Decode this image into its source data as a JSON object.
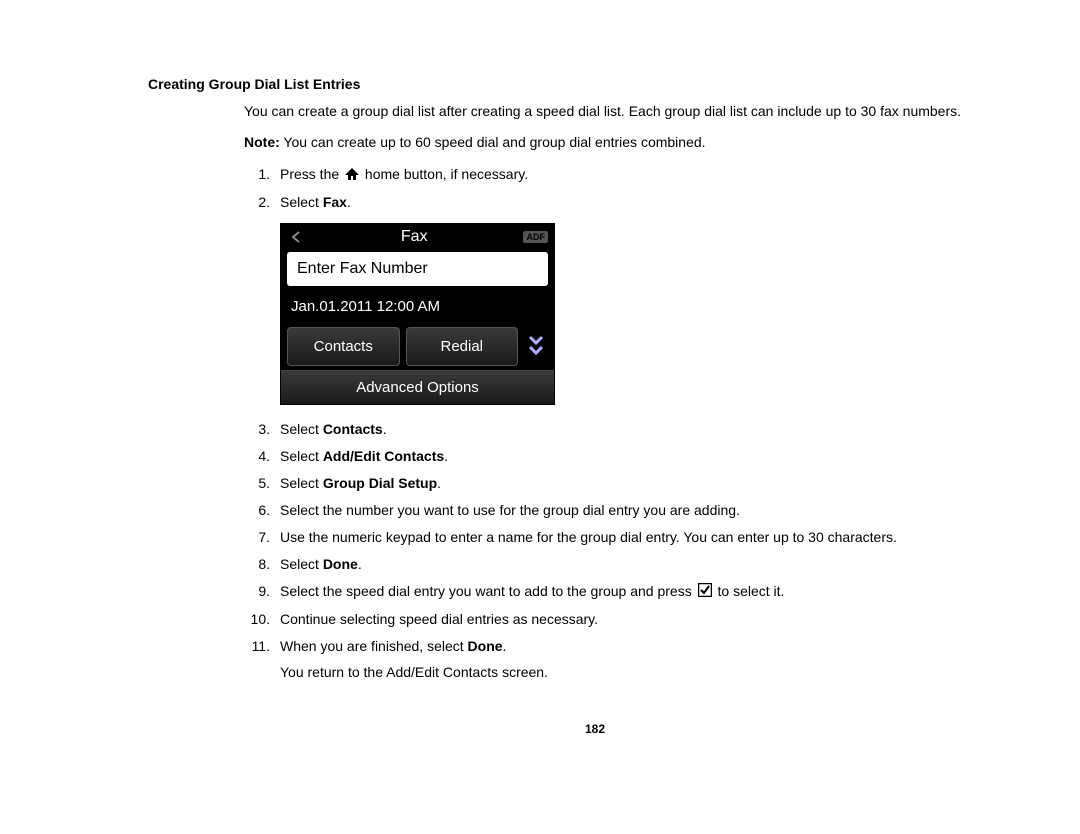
{
  "heading": "Creating Group Dial List Entries",
  "intro": "You can create a group dial list after creating a speed dial list. Each group dial list can include up to 30 fax numbers.",
  "note_label": "Note:",
  "note_text": " You can create up to 60 speed dial and group dial entries combined.",
  "steps": {
    "s1a": "Press the ",
    "s1b": " home button, if necessary.",
    "s2a": "Select ",
    "s2b": "Fax",
    "s2c": ".",
    "s3a": "Select ",
    "s3b": "Contacts",
    "s3c": ".",
    "s4a": "Select ",
    "s4b": "Add/Edit Contacts",
    "s4c": ".",
    "s5a": "Select ",
    "s5b": "Group Dial Setup",
    "s5c": ".",
    "s6": "Select the number you want to use for the group dial entry you are adding.",
    "s7": "Use the numeric keypad to enter a name for the group dial entry. You can enter up to 30 characters.",
    "s8a": "Select ",
    "s8b": "Done",
    "s8c": ".",
    "s9a": "Select the speed dial entry you want to add to the group and press ",
    "s9b": " to select it.",
    "s10": "Continue selecting speed dial entries as necessary.",
    "s11a": "When you are finished, select ",
    "s11b": "Done",
    "s11c": ".",
    "s11d": "You return to the Add/Edit Contacts screen."
  },
  "nums": {
    "n1": "1.",
    "n2": "2.",
    "n3": "3.",
    "n4": "4.",
    "n5": "5.",
    "n6": "6.",
    "n7": "7.",
    "n8": "8.",
    "n9": "9.",
    "n10": "10.",
    "n11": "11."
  },
  "screenshot": {
    "title": "Fax",
    "adf": "ADF",
    "input_placeholder": "Enter Fax Number",
    "datetime": "Jan.01.2011   12:00 AM",
    "contacts": "Contacts",
    "redial": "Redial",
    "advanced": "Advanced Options"
  },
  "page_number": "182"
}
